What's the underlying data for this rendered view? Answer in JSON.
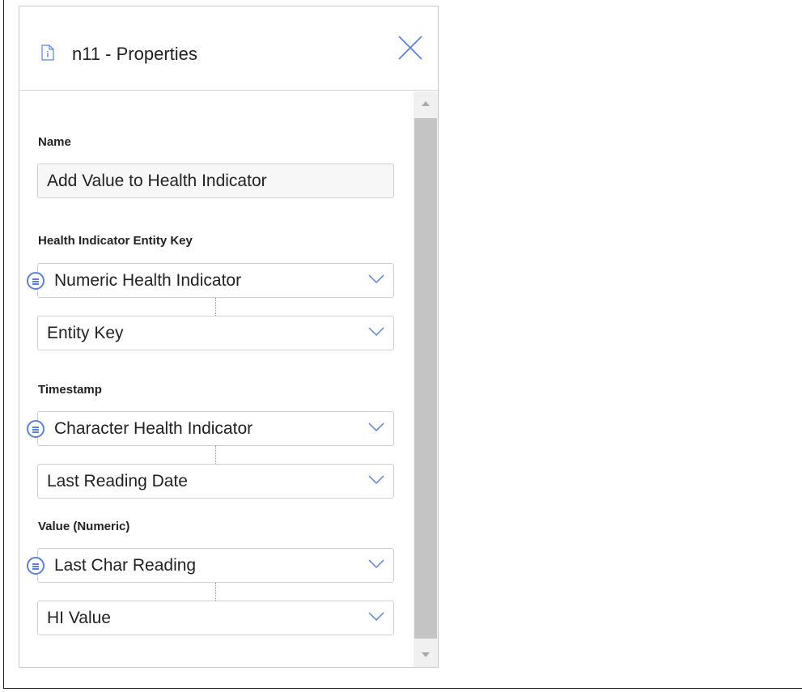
{
  "panel": {
    "title": "n11 - Properties",
    "icons": {
      "title": "document-info-icon",
      "close": "close-icon"
    }
  },
  "fields": {
    "name": {
      "label": "Name",
      "value": "Add Value to Health Indicator"
    },
    "entity_key": {
      "label": "Health Indicator Entity Key",
      "source": "Numeric Health Indicator",
      "property": "Entity Key"
    },
    "timestamp": {
      "label": "Timestamp",
      "source": "Character Health Indicator",
      "property": "Last Reading Date"
    },
    "value": {
      "label": "Value (Numeric)",
      "source": "Last Char Reading",
      "property": "HI Value"
    }
  },
  "colors": {
    "accent": "#5b82d8",
    "border": "#cfcfcf",
    "scroll_thumb": "#c4c4c4"
  }
}
